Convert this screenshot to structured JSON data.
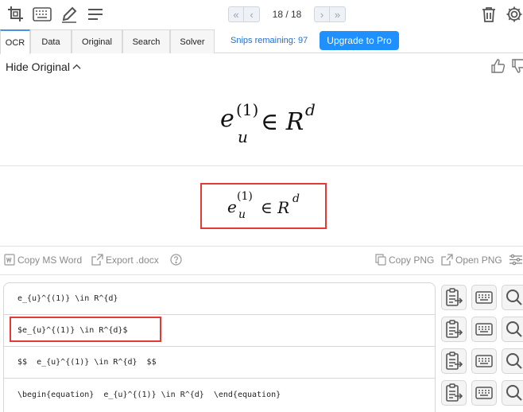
{
  "toolbar": {
    "icons": [
      "crop-icon",
      "keyboard-icon",
      "pen-icon",
      "menu-icon",
      "trash-icon",
      "gear-icon"
    ],
    "pager": {
      "current": 18,
      "total": 18,
      "label": "18 / 18"
    }
  },
  "tabs": [
    {
      "label": "OCR",
      "active": true
    },
    {
      "label": "Data"
    },
    {
      "label": "Original"
    },
    {
      "label": "Search"
    },
    {
      "label": "Solver"
    }
  ],
  "snips_remaining": "Snips remaining: 97",
  "upgrade_label": "Upgrade to Pro",
  "original": {
    "toggle_label": "Hide Original",
    "math": {
      "base": "e",
      "sub": "u",
      "sup": "(1)",
      "op": "∈",
      "set": "R",
      "set_sup": "d"
    }
  },
  "rendered": {
    "math": {
      "base": "e",
      "sub": "u",
      "sup": "(1)",
      "op": "∈",
      "set": "R",
      "set_sup": "d"
    }
  },
  "actions": {
    "copy_ms_word": "Copy MS Word",
    "export_docx": "Export .docx",
    "copy_png": "Copy PNG",
    "open_png": "Open PNG"
  },
  "results": [
    "e_{u}^{(1)} \\in R^{d}",
    "$e_{u}^{(1)} \\in R^{d}$",
    "$$  e_{u}^{(1)} \\in R^{d}  $$",
    "\\begin{equation}  e_{u}^{(1)} \\in R^{d}  \\end{equation}"
  ],
  "colors": {
    "accent": "#1e90ff",
    "link": "#1d6fd6",
    "highlight": "#e53935",
    "icon": "#555555"
  }
}
